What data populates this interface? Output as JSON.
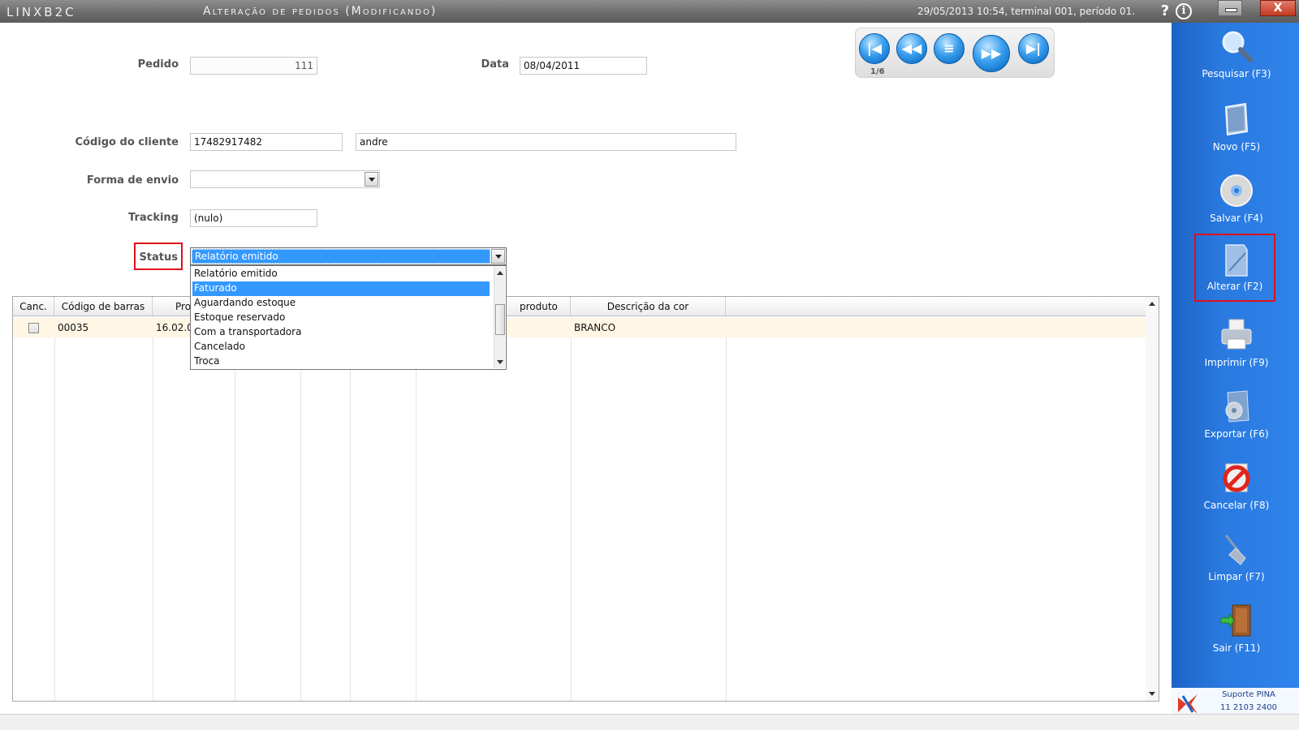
{
  "titlebar": {
    "app_name": "LINXB2C",
    "window_title": "Alteração de pedidos (Modificando)",
    "session_info": "29/05/2013 10:54, terminal 001, período 01.",
    "help": "?",
    "info": "i",
    "close": "X"
  },
  "form": {
    "pedido_label": "Pedido",
    "pedido_value": "111",
    "data_label": "Data",
    "data_value": "08/04/2011",
    "cliente_label": "Código do cliente",
    "cliente_code": "17482917482",
    "cliente_name": "andre",
    "envio_label": "Forma de envio",
    "envio_value": "",
    "tracking_label": "Tracking",
    "tracking_value": "(nulo)",
    "status_label": "Status",
    "status_value": "Relatório emitido"
  },
  "navigation": {
    "first": "|◀",
    "prev": "◀◀",
    "list": "≡",
    "next": "▶▶",
    "last": "▶|",
    "record_counter": "1/6"
  },
  "status_options": [
    "Relatório emitido",
    "Faturado",
    "Aguardando estoque",
    "Estoque reservado",
    "Com a transportadora",
    "Cancelado",
    "Troca"
  ],
  "status_highlighted_option": "Faturado",
  "grid": {
    "headers": [
      "Canc.",
      "Código de barras",
      "Pro",
      "",
      "",
      "",
      "produto",
      "Descrição da cor"
    ],
    "row": {
      "canc": false,
      "barcode": "00035",
      "produto_partial": "16.02.0",
      "cor": "BRANCO"
    }
  },
  "sidebar": {
    "items": [
      {
        "label": "Pesquisar (F3)",
        "icon": "magnifier-icon"
      },
      {
        "label": "Novo (F5)",
        "icon": "new-document-icon"
      },
      {
        "label": "Salvar (F4)",
        "icon": "disc-icon"
      },
      {
        "label": "Alterar (F2)",
        "icon": "edit-document-icon"
      },
      {
        "label": "Imprimir (F9)",
        "icon": "printer-icon"
      },
      {
        "label": "Exportar (F6)",
        "icon": "export-icon"
      },
      {
        "label": "Cancelar (F8)",
        "icon": "cancel-icon"
      },
      {
        "label": "Limpar (F7)",
        "icon": "broom-icon"
      },
      {
        "label": "Sair (F11)",
        "icon": "exit-door-icon"
      }
    ],
    "support_line1": "Suporte PINA",
    "support_line2": "11 2103 2400"
  },
  "colors": {
    "sidebar": "#2a7ae0",
    "selection": "#3399ff",
    "highlight_box": "#e0101a",
    "row_background": "#fff6e5"
  }
}
